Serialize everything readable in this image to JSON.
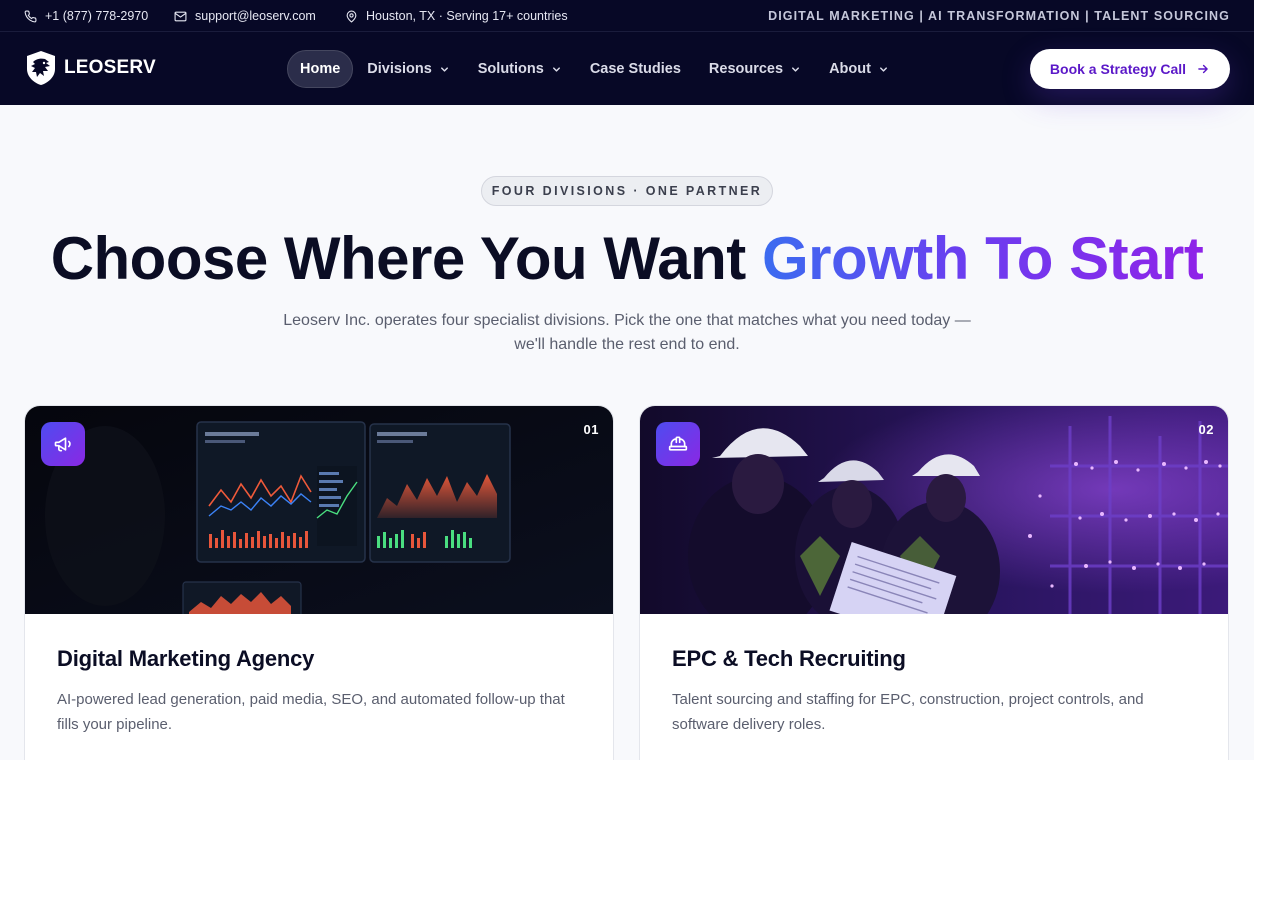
{
  "topbar": {
    "phone": "+1 (877) 778-2970",
    "email": "support@leoserv.com",
    "location": "Houston, TX · Serving 17+ countries",
    "tagline": "DIGITAL MARKETING | AI TRANSFORMATION | TALENT SOURCING"
  },
  "nav": {
    "logo_text": "LEOSERV",
    "items": [
      {
        "label": "Home",
        "active": true,
        "dropdown": false
      },
      {
        "label": "Divisions",
        "dropdown": true
      },
      {
        "label": "Solutions",
        "dropdown": true
      },
      {
        "label": "Case Studies",
        "dropdown": false
      },
      {
        "label": "Resources",
        "dropdown": true
      },
      {
        "label": "About",
        "dropdown": true
      }
    ],
    "cta_label": "Book a Strategy Call"
  },
  "hero": {
    "eyebrow": "FOUR DIVISIONS · ONE PARTNER",
    "headline_plain": "Choose Where You Want ",
    "headline_gradient": "Growth To Start",
    "subtitle": "Leoserv Inc. operates four specialist divisions. Pick the one that matches what you need today — we'll handle the rest end to end."
  },
  "cards": [
    {
      "number": "01",
      "icon": "megaphone-icon",
      "title": "Digital Marketing Agency",
      "description": "AI-powered lead generation, paid media, SEO, and automated follow-up that fills your pipeline."
    },
    {
      "number": "02",
      "icon": "hard-hat-icon",
      "title": "EPC & Tech Recruiting",
      "description": "Talent sourcing and staffing for EPC, construction, project controls, and software delivery roles."
    }
  ],
  "colors": {
    "nav_bg": "#070826",
    "cta_text": "#5b18c8",
    "gradient_start": "#3b6cf0",
    "gradient_end": "#8f23e8",
    "page_bg": "#f8f9fc"
  }
}
